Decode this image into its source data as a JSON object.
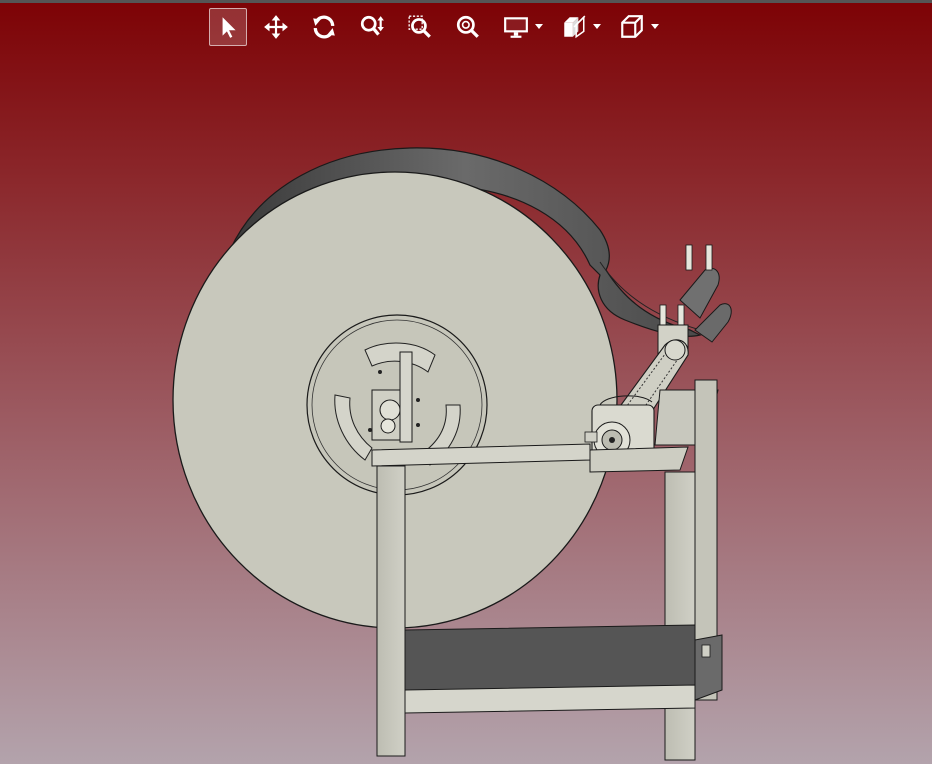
{
  "app": {
    "viewport": "3d-model-view",
    "background_top": "#7d0205",
    "background_bottom": "#b3a3ac"
  },
  "toolbar": {
    "items": [
      {
        "name": "select-tool",
        "icon": "cursor-icon",
        "active": true
      },
      {
        "name": "pan-tool",
        "icon": "move-arrows-icon",
        "active": false
      },
      {
        "name": "rotate-tool",
        "icon": "rotate-icon",
        "active": false
      },
      {
        "name": "zoom-tool",
        "icon": "zoom-updown-icon",
        "active": false
      },
      {
        "name": "zoom-window-tool",
        "icon": "zoom-window-icon",
        "active": false
      },
      {
        "name": "zoom-fit-tool",
        "icon": "zoom-fit-icon",
        "active": false
      },
      {
        "name": "display-mode-menu",
        "icon": "monitor-icon",
        "dropdown": true
      },
      {
        "name": "section-view-menu",
        "icon": "section-cube-icon",
        "dropdown": true
      },
      {
        "name": "view-orientation-menu",
        "icon": "cube-icon",
        "dropdown": true
      }
    ]
  },
  "model": {
    "description_icon": "cable-reel-machine",
    "drum_color": "#c8c8bc",
    "edge_color": "#1a1a1a",
    "shadow_color": "#5a5a5a"
  }
}
